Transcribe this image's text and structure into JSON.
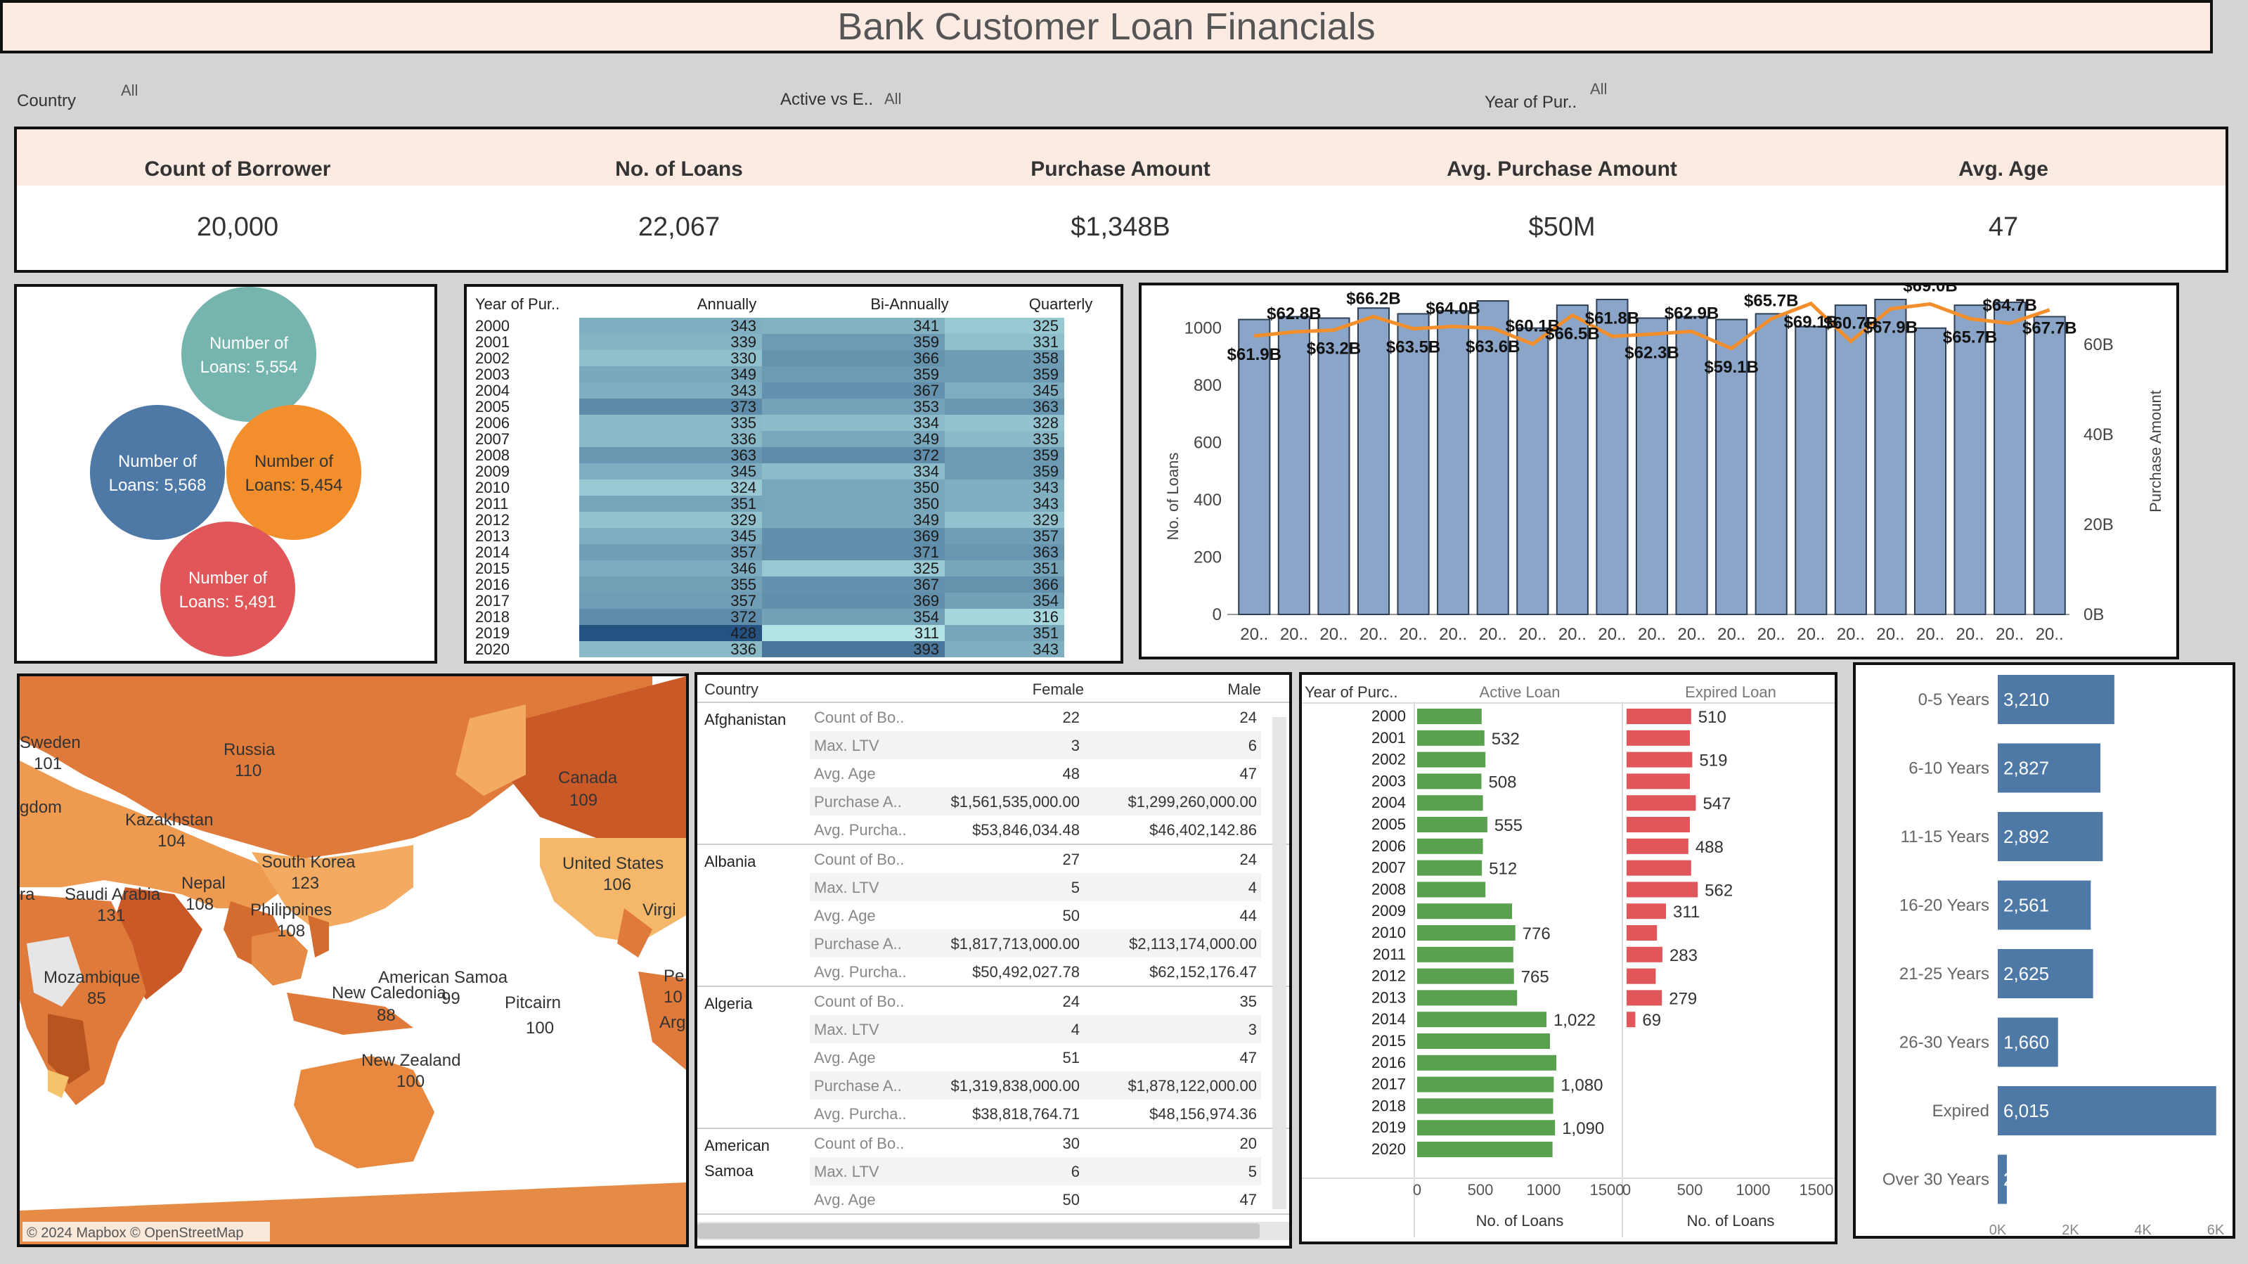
{
  "title": "Bank Customer Loan Financials",
  "filters": [
    {
      "label": "Country",
      "value": "All"
    },
    {
      "label": "Active vs E..",
      "value": "All"
    },
    {
      "label": "Year of Pur..",
      "value": "All"
    }
  ],
  "kpis": [
    {
      "label": "Count of Borrower",
      "value": "20,000"
    },
    {
      "label": "No. of Loans",
      "value": "22,067"
    },
    {
      "label": "Purchase Amount",
      "value": "$1,348B"
    },
    {
      "label": "Avg. Purchase Amount",
      "value": "$50M"
    },
    {
      "label": "Avg. Age",
      "value": "47"
    }
  ],
  "colors": {
    "teal": "#76b5ae",
    "blue": "#4e79a7",
    "orange": "#f28e2b",
    "red": "#e15759",
    "green": "#59a14f",
    "bar_blue": "#8aa5c8",
    "line_orange": "#f28e2b"
  },
  "bubbles": [
    {
      "line1": "Number of",
      "line2": "Loans: 5,554",
      "color": "#76b5ae"
    },
    {
      "line1": "Number of",
      "line2": "Loans: 5,568",
      "color": "#4e79a7"
    },
    {
      "line1": "Number of",
      "line2": "Loans: 5,454",
      "color": "#f28e2b"
    },
    {
      "line1": "Number of",
      "line2": "Loans: 5,491",
      "color": "#e15759"
    }
  ],
  "chart_data": [
    {
      "type": "heatmap",
      "row_header": "Year of Pur..",
      "columns": [
        "Annually",
        "Bi-Annually",
        "Quarterly"
      ],
      "rows": [
        "2000",
        "2001",
        "2002",
        "2003",
        "2004",
        "2005",
        "2006",
        "2007",
        "2008",
        "2009",
        "2010",
        "2011",
        "2012",
        "2013",
        "2014",
        "2015",
        "2016",
        "2017",
        "2018",
        "2019",
        "2020"
      ],
      "values": [
        [
          343,
          341,
          325
        ],
        [
          339,
          359,
          331
        ],
        [
          330,
          366,
          358
        ],
        [
          349,
          359,
          359
        ],
        [
          343,
          367,
          345
        ],
        [
          373,
          353,
          363
        ],
        [
          335,
          334,
          328
        ],
        [
          336,
          349,
          335
        ],
        [
          363,
          372,
          359
        ],
        [
          345,
          334,
          359
        ],
        [
          324,
          350,
          343
        ],
        [
          351,
          350,
          343
        ],
        [
          329,
          349,
          329
        ],
        [
          345,
          369,
          357
        ],
        [
          357,
          371,
          363
        ],
        [
          346,
          325,
          351
        ],
        [
          355,
          367,
          366
        ],
        [
          357,
          369,
          354
        ],
        [
          372,
          354,
          316
        ],
        [
          428,
          311,
          351
        ],
        [
          336,
          393,
          343
        ]
      ]
    },
    {
      "type": "bar",
      "subtype": "bar+line",
      "categories": [
        "20..",
        "20..",
        "20..",
        "20..",
        "20..",
        "20..",
        "20..",
        "20..",
        "20..",
        "20..",
        "20..",
        "20..",
        "20..",
        "20..",
        "20..",
        "20..",
        "20..",
        "20..",
        "20..",
        "20..",
        "20.."
      ],
      "series": [
        {
          "name": "No. of Loans",
          "values": [
            1030,
            1040,
            1035,
            1070,
            1050,
            1060,
            1095,
            1000,
            1080,
            1100,
            1035,
            1040,
            1030,
            1050,
            1005,
            1080,
            1100,
            1000,
            1080,
            1090,
            1040
          ]
        },
        {
          "name": "Purchase Amount",
          "values": [
            61.9,
            62.8,
            63.2,
            66.2,
            63.5,
            64.0,
            63.6,
            60.1,
            66.5,
            61.8,
            62.3,
            62.9,
            59.1,
            65.7,
            69.1,
            60.7,
            67.9,
            69.0,
            65.7,
            64.7,
            67.7
          ]
        }
      ],
      "data_labels": [
        "$61.9B",
        "$62.8B",
        "$63.2B",
        "$66.2B",
        "$63.5B",
        "$64.0B",
        "$63.6B",
        "$60.1B",
        "$66.5B",
        "$61.8B",
        "$62.3B",
        "$62.9B",
        "$59.1B",
        "$65.7B",
        "$69.1B",
        "$60.7B",
        "$67.9B",
        "$69.0B",
        "$65.7B",
        "$64.7B",
        "$67.7B"
      ],
      "ylabel": "No. of Loans",
      "y2label": "Purchase Amount",
      "ylim": [
        0,
        1100
      ],
      "yticks": [
        0,
        200,
        400,
        600,
        800,
        1000
      ],
      "y2ticks": [
        "0B",
        "20B",
        "40B",
        "60B"
      ],
      "y2lim": [
        0,
        70
      ]
    },
    {
      "type": "bar",
      "orientation": "horizontal",
      "row_header": "Year of Purc..",
      "categories": [
        "2000",
        "2001",
        "2002",
        "2003",
        "2004",
        "2005",
        "2006",
        "2007",
        "2008",
        "2009",
        "2010",
        "2011",
        "2012",
        "2013",
        "2014",
        "2015",
        "2016",
        "2017",
        "2018",
        "2019",
        "2020"
      ],
      "series": [
        {
          "name": "Active Loan",
          "values": [
            510,
            532,
            540,
            508,
            520,
            555,
            520,
            512,
            540,
            750,
            776,
            760,
            765,
            790,
            1022,
            1050,
            1100,
            1080,
            1075,
            1090,
            1070
          ],
          "labels": {
            "2001": "532",
            "2003": "508",
            "2005": "555",
            "2007": "512",
            "2010": "776",
            "2012": "765",
            "2014": "1,022",
            "2017": "1,080",
            "2019": "1,090"
          }
        },
        {
          "name": "Expired Loan",
          "values": [
            510,
            500,
            519,
            500,
            547,
            500,
            488,
            510,
            562,
            311,
            240,
            283,
            230,
            279,
            69,
            0,
            0,
            0,
            0,
            0,
            0
          ],
          "labels": {
            "2000": "510",
            "2002": "519",
            "2004": "547",
            "2006": "488",
            "2008": "562",
            "2009": "311",
            "2011": "283",
            "2013": "279",
            "2014": "69"
          }
        }
      ],
      "xlabel": "No. of Loans",
      "xticks": [
        "0",
        "500",
        "1000",
        "1500"
      ],
      "xlim": [
        0,
        1500
      ]
    },
    {
      "type": "bar",
      "orientation": "horizontal",
      "categories": [
        "0-5 Years",
        "6-10 Years",
        "11-15 Years",
        "16-20 Years",
        "21-25 Years",
        "26-30 Years",
        "Expired",
        "Over 30 Years"
      ],
      "values": [
        3210,
        2827,
        2892,
        2561,
        2625,
        1660,
        6015,
        250
      ],
      "labels": [
        "3,210",
        "2,827",
        "2,892",
        "2,561",
        "2,625",
        "1,660",
        "6,015",
        "2"
      ],
      "xticks": [
        "0K",
        "2K",
        "4K",
        "6K"
      ],
      "xlim": [
        0,
        6000
      ]
    }
  ],
  "map": {
    "attribution": "© 2024 Mapbox © OpenStreetMap",
    "labels": [
      {
        "name": "Sweden",
        "value": "101"
      },
      {
        "name": "Russia",
        "value": "110"
      },
      {
        "name": "Canada",
        "value": "109"
      },
      {
        "name": "gdom",
        "value": ""
      },
      {
        "name": "Kazakhstan",
        "value": "104"
      },
      {
        "name": "South Korea",
        "value": "123"
      },
      {
        "name": "United States",
        "value": "106"
      },
      {
        "name": "Nepal",
        "value": "108"
      },
      {
        "name": "ra",
        "value": ""
      },
      {
        "name": "Saudi Arabia",
        "value": "131"
      },
      {
        "name": "Philippines",
        "value": "108"
      },
      {
        "name": "Virgi",
        "value": ""
      },
      {
        "name": "Mozambique",
        "value": "85"
      },
      {
        "name": "American Samoa",
        "value": "99"
      },
      {
        "name": "New Caledonia",
        "value": "88"
      },
      {
        "name": "Pitcairn",
        "value": "100"
      },
      {
        "name": "Pe",
        "value": "10"
      },
      {
        "name": "Arg",
        "value": ""
      },
      {
        "name": "New Zealand",
        "value": "100"
      }
    ]
  },
  "table": {
    "headers": [
      "Country",
      "",
      "Female",
      "Male"
    ],
    "groups": [
      {
        "country": "Afghanistan",
        "rows": [
          {
            "m": "Count of Bo..",
            "f": "22",
            "ma": "24"
          },
          {
            "m": "Max. LTV",
            "f": "3",
            "ma": "6"
          },
          {
            "m": "Avg. Age",
            "f": "48",
            "ma": "47"
          },
          {
            "m": "Purchase A..",
            "f": "$1,561,535,000.00",
            "ma": "$1,299,260,000.00"
          },
          {
            "m": "Avg. Purcha..",
            "f": "$53,846,034.48",
            "ma": "$46,402,142.86"
          }
        ]
      },
      {
        "country": "Albania",
        "rows": [
          {
            "m": "Count of Bo..",
            "f": "27",
            "ma": "24"
          },
          {
            "m": "Max. LTV",
            "f": "5",
            "ma": "4"
          },
          {
            "m": "Avg. Age",
            "f": "50",
            "ma": "44"
          },
          {
            "m": "Purchase A..",
            "f": "$1,817,713,000.00",
            "ma": "$2,113,174,000.00"
          },
          {
            "m": "Avg. Purcha..",
            "f": "$50,492,027.78",
            "ma": "$62,152,176.47"
          }
        ]
      },
      {
        "country": "Algeria",
        "rows": [
          {
            "m": "Count of Bo..",
            "f": "24",
            "ma": "35"
          },
          {
            "m": "Max. LTV",
            "f": "4",
            "ma": "3"
          },
          {
            "m": "Avg. Age",
            "f": "51",
            "ma": "47"
          },
          {
            "m": "Purchase A..",
            "f": "$1,319,838,000.00",
            "ma": "$1,878,122,000.00"
          },
          {
            "m": "Avg. Purcha..",
            "f": "$38,818,764.71",
            "ma": "$48,156,974.36"
          }
        ]
      },
      {
        "country": "American Samoa",
        "rows": [
          {
            "m": "Count of Bo..",
            "f": "30",
            "ma": "20"
          },
          {
            "m": "Max. LTV",
            "f": "6",
            "ma": "5"
          },
          {
            "m": "Avg. Age",
            "f": "50",
            "ma": "47"
          }
        ]
      }
    ]
  }
}
